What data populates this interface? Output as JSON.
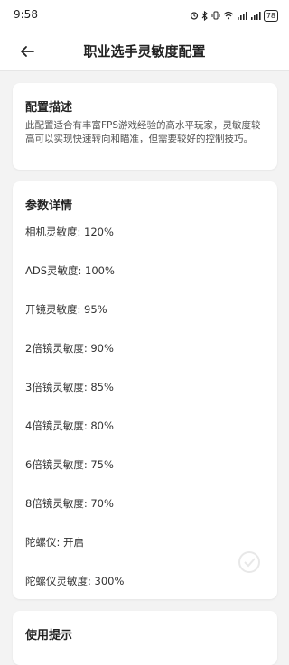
{
  "status_bar": {
    "time": "9:58",
    "battery": "78",
    "net_speed": "≈"
  },
  "app_bar": {
    "title": "职业选手灵敏度配置"
  },
  "description": {
    "title": "配置描述",
    "text": "此配置适合有丰富FPS游戏经验的高水平玩家，灵敏度较高可以实现快速转向和瞄准，但需要较好的控制技巧。"
  },
  "params": {
    "title": "参数详情",
    "items": [
      "相机灵敏度: 120%",
      "ADS灵敏度: 100%",
      "开镜灵敏度: 95%",
      "2倍镜灵敏度: 90%",
      "3倍镜灵敏度: 85%",
      "4倍镜灵敏度: 80%",
      "6倍镜灵敏度: 75%",
      "8倍镜灵敏度: 70%",
      "陀螺仪: 开启",
      "陀螺仪灵敏度: 300%"
    ]
  },
  "tips": {
    "title": "使用提示"
  }
}
